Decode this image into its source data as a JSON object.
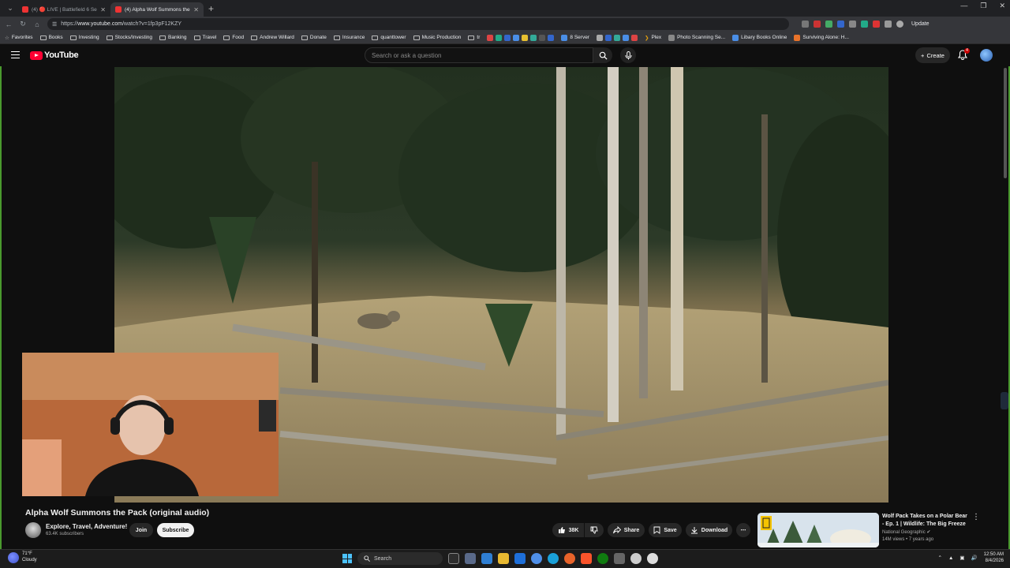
{
  "browser": {
    "tabs": [
      {
        "label": "(4) 🔴 LIVE | Battlefield 6 Season ..."
      },
      {
        "label": "(4) Alpha Wolf Summons the ..."
      }
    ],
    "url_prefix": "https://",
    "url_host": "www.youtube.com",
    "url_path": "/watch?v=1fp3pF12KZY",
    "update_label": "Update",
    "bookmarks": [
      "Favorites",
      "Books",
      "Investing",
      "Stocks/Investing",
      "Banking",
      "Travel",
      "Food",
      "Andrew Willard",
      "Donate",
      "Insurance",
      "quanttower",
      "Music Production",
      "tr",
      "8 Server",
      "Plex",
      "Photo Scanning Se...",
      "Libary Books Online",
      "Surviving Alone: H..."
    ]
  },
  "youtube": {
    "logo": "YouTube",
    "search_placeholder": "Search or ask a question",
    "create_label": "Create",
    "notif_count": "4"
  },
  "video": {
    "title": "Alpha Wolf Summons the Pack (original audio)",
    "channel": "Explore, Travel, Adventure!",
    "subscribers": "63.4K subscribers",
    "join_label": "Join",
    "subscribe_label": "Subscribe",
    "likes": "38K",
    "share_label": "Share",
    "save_label": "Save",
    "download_label": "Download"
  },
  "recommendation": {
    "title": "Wolf Pack Takes on a Polar Bear - Ep. 1 | Wildlife: The Big Freeze",
    "channel": "National Geographic",
    "meta": "14M views • 7 years ago"
  },
  "taskbar": {
    "temperature": "71°F",
    "condition": "Cloudy",
    "search_label": "Search",
    "time": "12:50 AM",
    "date": "8/4/2026"
  },
  "colors": {
    "accent_red": "#ff0033",
    "frame_green": "#4a9a2e"
  }
}
